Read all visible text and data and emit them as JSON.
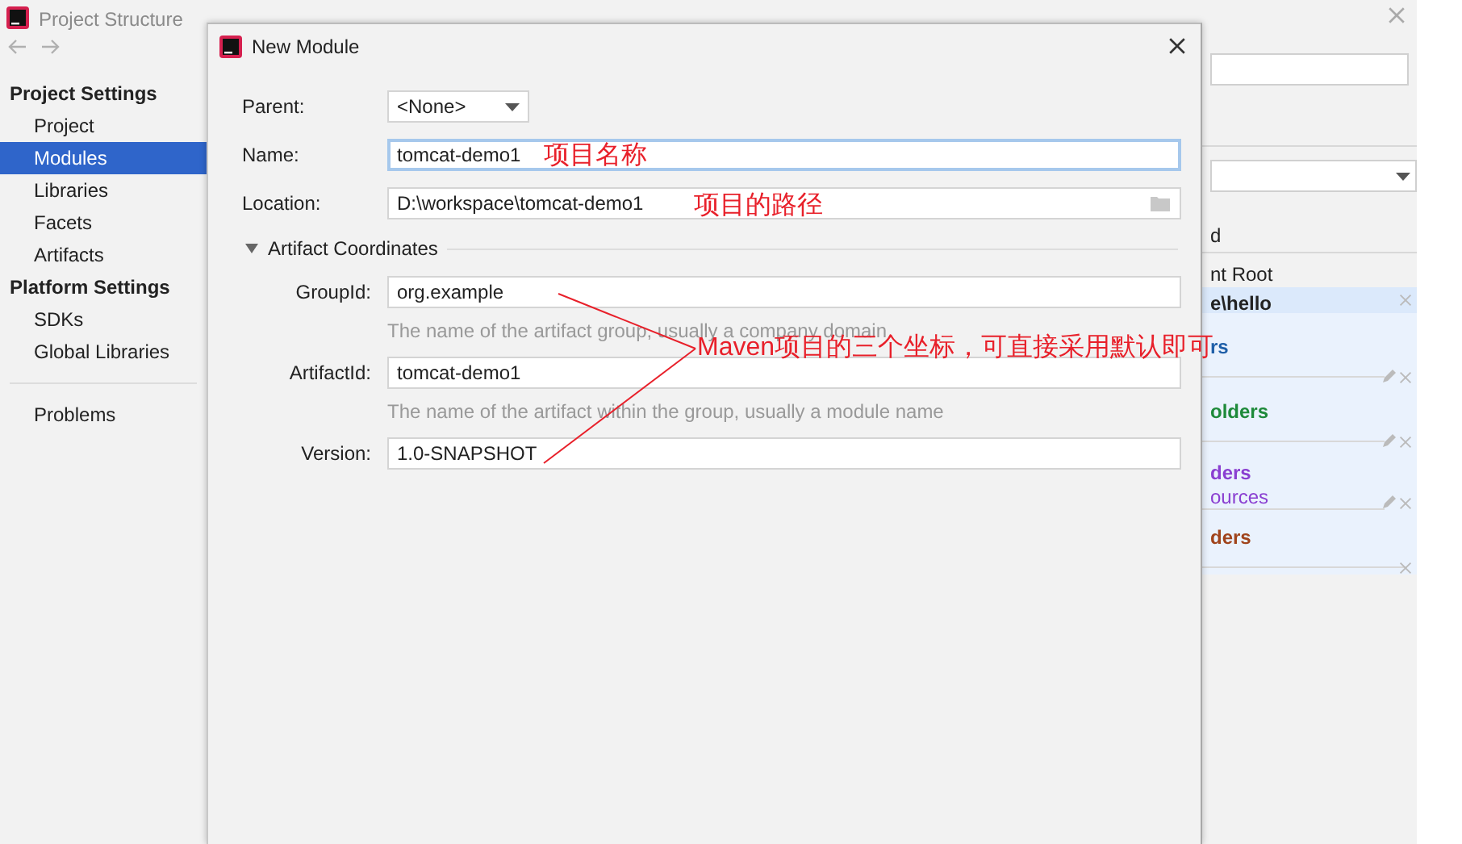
{
  "background_window": {
    "title": "Project Structure",
    "sidebar": {
      "sections": [
        {
          "heading": "Project Settings",
          "items": [
            {
              "label": "Project",
              "selected": false
            },
            {
              "label": "Modules",
              "selected": true
            },
            {
              "label": "Libraries",
              "selected": false
            },
            {
              "label": "Facets",
              "selected": false
            },
            {
              "label": "Artifacts",
              "selected": false
            }
          ]
        },
        {
          "heading": "Platform Settings",
          "items": [
            {
              "label": "SDKs",
              "selected": false
            },
            {
              "label": "Global Libraries",
              "selected": false
            }
          ]
        }
      ],
      "bottom_items": [
        {
          "label": "Problems",
          "selected": false
        }
      ]
    },
    "right_panel": {
      "header": "d",
      "content_root": {
        "label": "nt Root",
        "path": "e\\hello"
      },
      "folder_groups": [
        {
          "title": "rs",
          "color": "#1f5fa8",
          "editable": true
        },
        {
          "title": "olders",
          "color": "#1e8a3a",
          "editable": true
        },
        {
          "title": "ders",
          "color": "#8a3fd1",
          "entry": "ources",
          "editable": true
        },
        {
          "title": "ders",
          "color": "#a0441c",
          "editable": false
        }
      ]
    }
  },
  "dialog": {
    "title": "New Module",
    "fields": [
      {
        "label": "Parent:",
        "kind": "select",
        "value": "<None>",
        "focused": false
      },
      {
        "label": "Name:",
        "kind": "text",
        "value": "tomcat-demo1",
        "focused": true
      },
      {
        "label": "Location:",
        "kind": "path",
        "value": "D:\\workspace\\tomcat-demo1",
        "focused": false
      }
    ],
    "section": {
      "title": "Artifact Coordinates",
      "expanded": true,
      "fields": [
        {
          "label": "GroupId:",
          "value": "org.example",
          "hint": "The name of the artifact group, usually a company domain"
        },
        {
          "label": "ArtifactId:",
          "value": "tomcat-demo1",
          "hint": "The name of the artifact within the group, usually a module name"
        },
        {
          "label": "Version:",
          "value": "1.0-SNAPSHOT"
        }
      ]
    }
  },
  "annotations": [
    {
      "text": "项目名称"
    },
    {
      "text": "项目的路径"
    },
    {
      "text": "Maven项目的三个坐标，可直接采用默认即可"
    }
  ]
}
